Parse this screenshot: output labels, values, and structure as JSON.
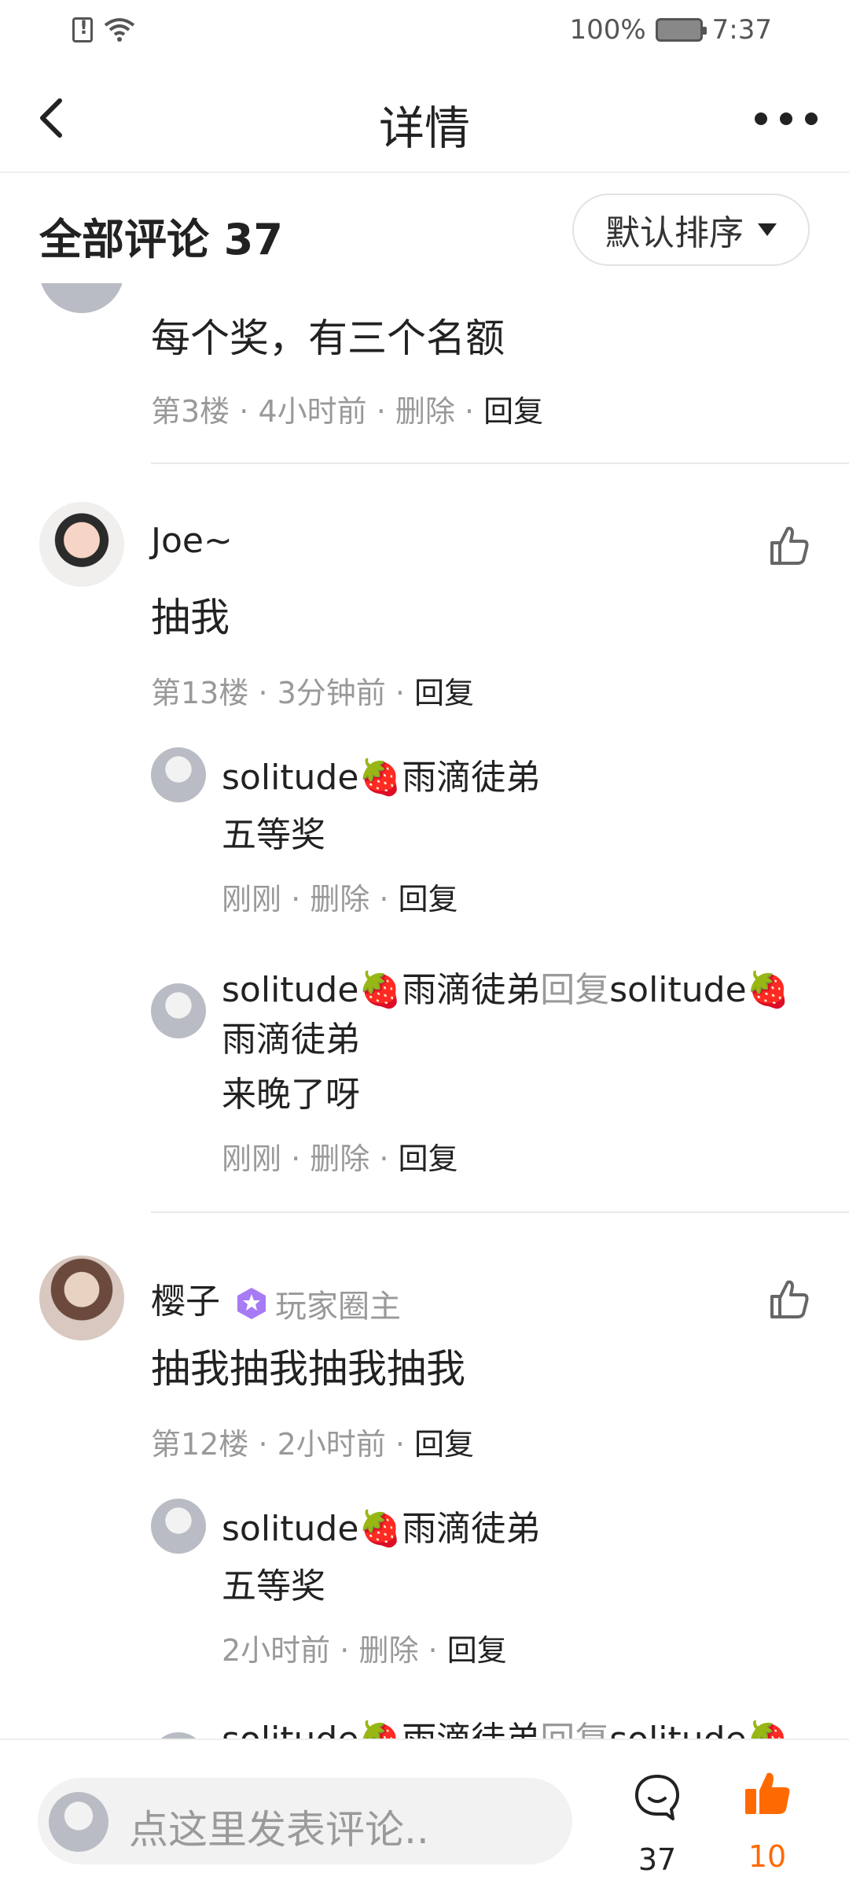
{
  "status_bar": {
    "battery": "100%",
    "time": "7:37"
  },
  "header": {
    "title": "详情"
  },
  "section": {
    "title": "全部评论 37",
    "sort_label": "默认排序"
  },
  "comments": [
    {
      "text": "每个奖，有三个名额",
      "floor": "第3楼",
      "time": "4小时前",
      "delete": "删除",
      "reply": "回复"
    },
    {
      "user": "Joe~",
      "text": "抽我",
      "floor": "第13楼",
      "time": "3分钟前",
      "reply": "回复",
      "replies": [
        {
          "user": "solitude🍓雨滴徒弟",
          "text": "五等奖",
          "time": "刚刚",
          "delete": "删除",
          "reply": "回复"
        },
        {
          "user": "solitude🍓雨滴徒弟",
          "reply_word": "回复",
          "target": "solitude🍓",
          "target_cont": "雨滴徒弟",
          "text": "来晚了呀",
          "time": "刚刚",
          "delete": "删除",
          "reply": "回复"
        }
      ]
    },
    {
      "user": "樱子",
      "role": "玩家圈主",
      "text": "抽我抽我抽我抽我",
      "floor": "第12楼",
      "time": "2小时前",
      "reply": "回复",
      "replies": [
        {
          "user": "solitude🍓雨滴徒弟",
          "text": "五等奖",
          "time": "2小时前",
          "delete": "删除",
          "reply": "回复"
        },
        {
          "user": "solitude🍓雨滴徒弟",
          "reply_word": "回复",
          "target": "solitude🍓"
        }
      ]
    }
  ],
  "bottom_bar": {
    "placeholder": "点这里发表评论..",
    "comment_count": "37",
    "like_count": "10"
  },
  "colors": {
    "accent": "#ff6a00",
    "meta": "#999999"
  }
}
